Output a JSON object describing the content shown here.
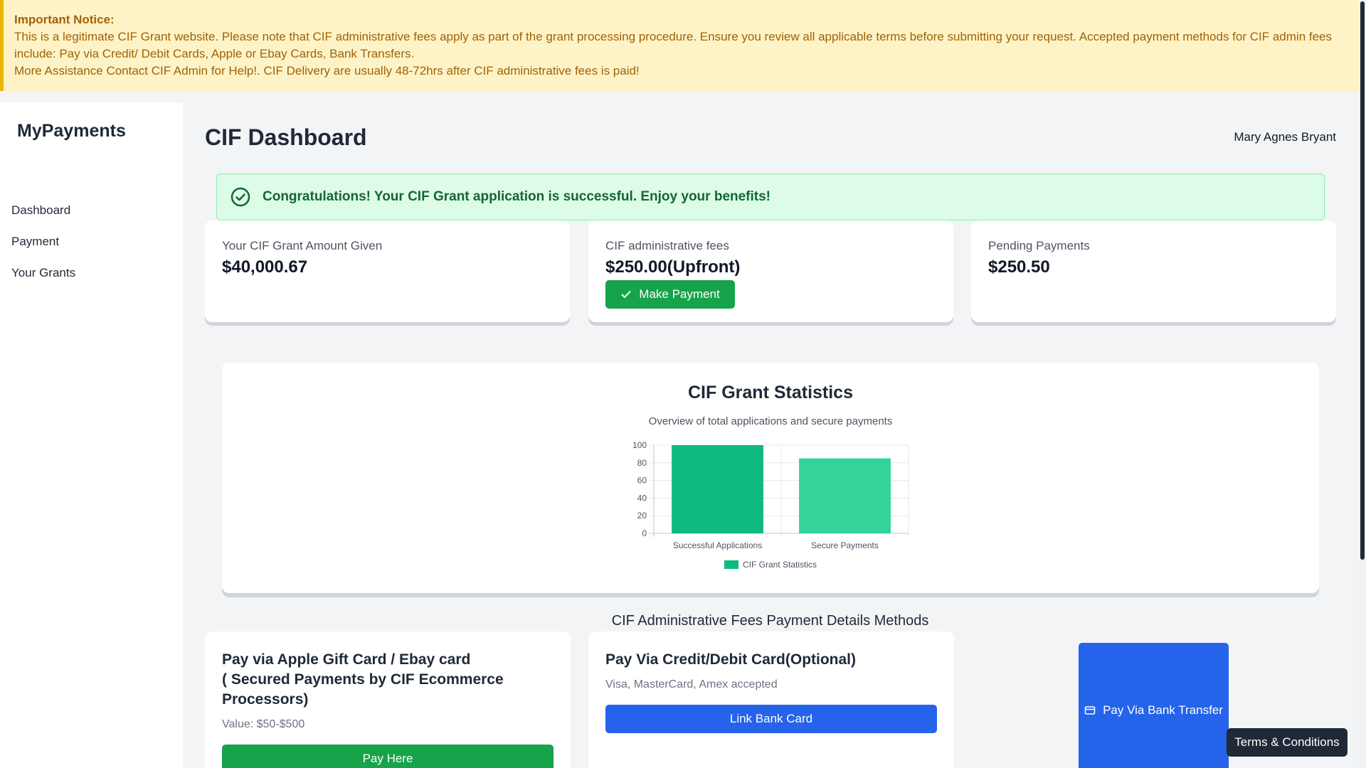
{
  "notice": {
    "title": "Important Notice:",
    "line1": "This is a legitimate CIF Grant website. Please note that CIF administrative fees apply as part of the grant processing procedure. Ensure you review all applicable terms before submitting your request. Accepted payment methods for CIF admin fees include: Pay via Credit/ Debit Cards, Apple or Ebay Cards, Bank Transfers.",
    "line2": "More Assistance Contact CIF Admin for Help!. CIF Delivery are usually 48-72hrs after CIF administrative fees is paid!"
  },
  "sidebar": {
    "brand": "MyPayments",
    "items": [
      {
        "label": "Dashboard"
      },
      {
        "label": "Payment"
      },
      {
        "label": "Your Grants"
      }
    ]
  },
  "header": {
    "title": "CIF Dashboard",
    "user": "Mary Agnes Bryant"
  },
  "alert": {
    "text": "Congratulations! Your CIF Grant application is successful. Enjoy your benefits!",
    "icon": "check-circle-icon"
  },
  "stats": [
    {
      "label": "Your CIF Grant Amount Given",
      "value": "$40,000.67"
    },
    {
      "label": "CIF administrative fees",
      "value": "$250.00(Upfront)",
      "button": "Make Payment"
    },
    {
      "label": "Pending Payments",
      "value": "$250.50"
    }
  ],
  "chart_data": {
    "type": "bar",
    "title": "CIF Grant Statistics",
    "subtitle": "Overview of total applications and secure payments",
    "categories": [
      "Successful Applications",
      "Secure Payments"
    ],
    "series": [
      {
        "name": "CIF Grant Statistics",
        "values": [
          100,
          85
        ]
      }
    ],
    "colors": [
      "#10b981",
      "#34d399"
    ],
    "ylim": [
      0,
      100
    ],
    "yticks": [
      0,
      20,
      40,
      60,
      80,
      100
    ],
    "grid": true,
    "legend": "bottom"
  },
  "payment_section": {
    "title": "CIF Administrative Fees Payment Details Methods",
    "gift_card": {
      "title_line1": "Pay via Apple Gift Card / Ebay card",
      "title_line2": "( Secured Payments by CIF Ecommerce",
      "title_line3": "Processors)",
      "subtitle": "Value: $50-$500",
      "button": "Pay Here"
    },
    "credit_card": {
      "title": "Pay Via Credit/Debit Card(Optional)",
      "subtitle": "Visa, MasterCard, Amex accepted",
      "button": "Link Bank Card"
    },
    "bank_transfer": {
      "button": "Pay Via Bank Transfer"
    }
  },
  "terms": {
    "label": "Terms & Conditions"
  },
  "colors": {
    "success": "#16a34a",
    "primary": "#2563eb",
    "notice_bg": "#fef3c7",
    "notice_text": "#a16207"
  }
}
